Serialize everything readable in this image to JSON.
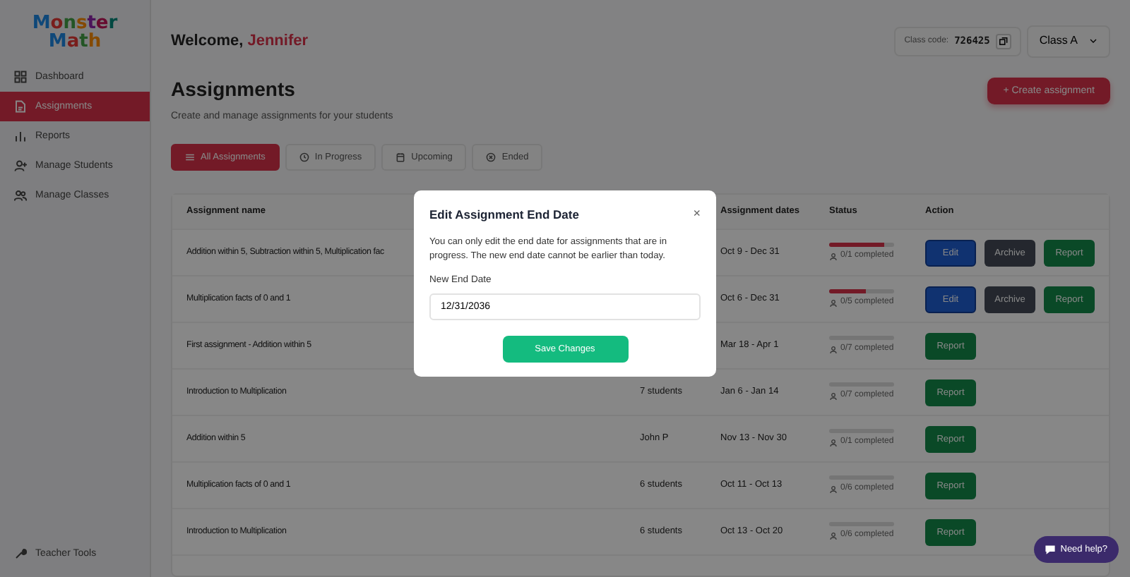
{
  "logo": "Monster Math",
  "sidebar": {
    "items": [
      {
        "label": "Dashboard",
        "selected": false
      },
      {
        "label": "Assignments",
        "selected": true
      },
      {
        "label": "Reports",
        "selected": false
      },
      {
        "label": "Manage Students",
        "selected": false
      },
      {
        "label": "Manage Classes",
        "selected": false
      }
    ],
    "footer": {
      "label": "Teacher Tools"
    }
  },
  "header": {
    "greeting": "Welcome,",
    "name": "Jennifer",
    "class_code_label": "Class code:",
    "class_code": "726425",
    "class_select": "Class A"
  },
  "page": {
    "title": "Assignments",
    "subtitle": "Create and manage assignments for your students",
    "create_button": "+ Create assignment"
  },
  "filters": [
    {
      "label": "All Assignments",
      "selected": true
    },
    {
      "label": "In Progress",
      "selected": false
    },
    {
      "label": "Upcoming",
      "selected": false
    },
    {
      "label": "Ended",
      "selected": false
    }
  ],
  "table": {
    "columns": [
      "Assignment name",
      "Assignment dates",
      "Status",
      "Action"
    ],
    "rows": [
      {
        "name": "Addition within 5, Subtraction within 5, Multiplication fac",
        "assigned": "",
        "dates": "Oct 9 - Dec 31",
        "level": 0.85,
        "completed": "0/1 completed",
        "actions": [
          "Edit",
          "Archive",
          "Report"
        ]
      },
      {
        "name": "Multiplication facts of 0 and 1",
        "assigned": "",
        "dates": "Oct 6 - Dec 31",
        "level": 0.57,
        "completed": "0/5 completed",
        "actions": [
          "Edit",
          "Archive",
          "Report"
        ]
      },
      {
        "name": "First assignment - Addition within 5",
        "assigned": "",
        "dates": "Mar 18 - Apr 1",
        "level": 0,
        "completed": "0/7 completed",
        "actions": [
          "Report"
        ]
      },
      {
        "name": "Introduction to Multiplication",
        "assigned": "7 students",
        "dates": "Jan 6 - Jan 14",
        "level": 0,
        "completed": "0/7 completed",
        "actions": [
          "Report"
        ]
      },
      {
        "name": "Addition within 5",
        "assigned": "John P",
        "dates": "Nov 13 - Nov 30",
        "level": 0,
        "completed": "0/1 completed",
        "actions": [
          "Report"
        ]
      },
      {
        "name": "Multiplication facts of 0 and 1",
        "assigned": "6 students",
        "dates": "Oct 11 - Oct 13",
        "level": 0,
        "completed": "0/6 completed",
        "actions": [
          "Report"
        ]
      },
      {
        "name": "Introduction to Multiplication",
        "assigned": "6 students",
        "dates": "Oct 13 - Oct 20",
        "level": 0,
        "completed": "0/6 completed",
        "actions": [
          "Report"
        ]
      }
    ]
  },
  "help_button": "Need help?",
  "modal": {
    "title": "Edit Assignment End Date",
    "close": "×",
    "message": "You can only edit the end date for assignments that are in progress. The new end date cannot be earlier than today.",
    "field_label": "New End Date",
    "field_value": "12/31/2036",
    "save": "Save Changes"
  }
}
